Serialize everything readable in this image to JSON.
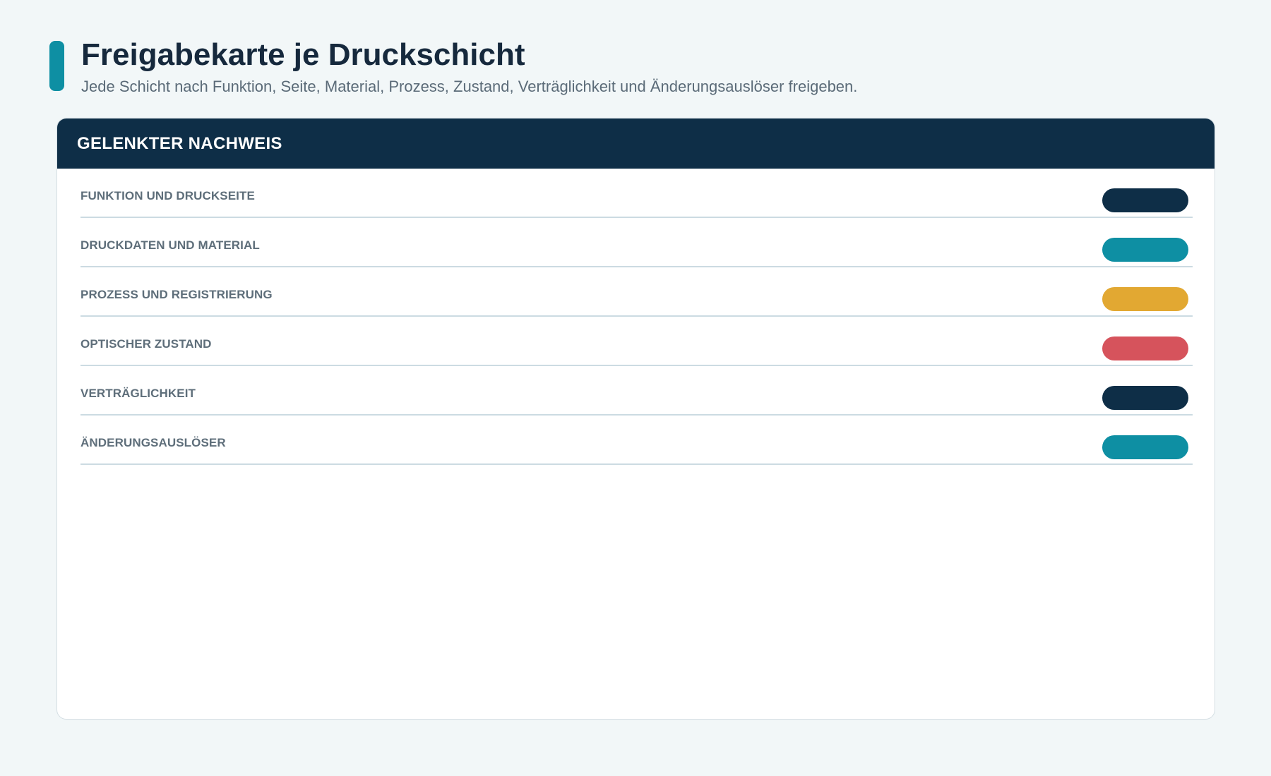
{
  "header": {
    "title": "Freigabekarte je Druckschicht",
    "subtitle": "Jede Schicht nach Funktion, Seite, Material, Prozess, Zustand, Verträglichkeit und Änderungsauslöser freigeben."
  },
  "card": {
    "title": "GELENKTER NACHWEIS",
    "rows": [
      {
        "label": "FUNKTION UND DRUCKSEITE",
        "color": "#0e2e47"
      },
      {
        "label": "DRUCKDATEN UND MATERIAL",
        "color": "#0e8fa3"
      },
      {
        "label": "PROZESS UND REGISTRIERUNG",
        "color": "#e2a832"
      },
      {
        "label": "OPTISCHER ZUSTAND",
        "color": "#d6535c"
      },
      {
        "label": "VERTRÄGLICHKEIT",
        "color": "#0e2e47"
      },
      {
        "label": "ÄNDERUNGSAUSLÖSER",
        "color": "#0e8fa3"
      }
    ]
  },
  "colors": {
    "accent": "#0e8fa3",
    "navy": "#0e2e47",
    "background": "#f2f7f8"
  }
}
